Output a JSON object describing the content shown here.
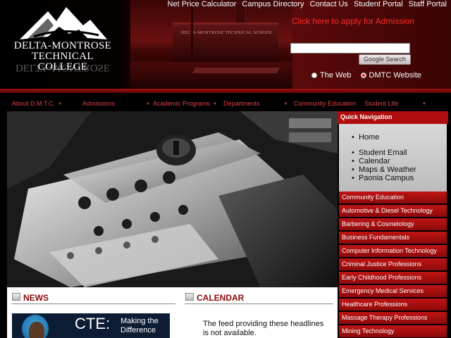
{
  "header": {
    "logo_name": "DELTA-MONTROSE",
    "logo_sub": "TECHNICAL COLLEGE",
    "photo_sign": "DELTA-MONTROSE TECHNICAL SCHOOL",
    "toplinks": [
      "Net Price Calculator",
      "Campus Directory",
      "Contact Us",
      "Student Portal",
      "Staff Portal"
    ],
    "apply_link": "Click here to apply for Admission",
    "search": {
      "value": "",
      "button_label": "Google Search"
    },
    "scope": {
      "options": [
        "The Web",
        "DMTC Website"
      ],
      "selected": "DMTC Website"
    }
  },
  "nav": [
    {
      "label": "About D.M.T.C."
    },
    {
      "label": "Admissions"
    },
    {
      "label": "Academic Programs"
    },
    {
      "label": "Departments"
    },
    {
      "label": "Community Education"
    },
    {
      "label": "Student Life"
    }
  ],
  "quick_nav": {
    "title": "Quick Navigation",
    "links": [
      "Home",
      "Student Email",
      "Calendar",
      "Maps & Weather",
      "Paonia Campus"
    ],
    "programs": [
      "Community Education",
      "Automotive & Diesel Technology",
      "Barbering & Cosmetology",
      "Business Fundamentals",
      "Computer Information Technology",
      "Criminal Justice Professions",
      "Early Childhood Professions",
      "Emergency Medical Services",
      "Healthcare Professions",
      "Massage Therapy Professions",
      "Mining Technology"
    ]
  },
  "news": {
    "title": "NEWS",
    "banner": {
      "big": "CTE:",
      "line1": "Making the",
      "line2": "Difference"
    }
  },
  "calendar": {
    "title": "CALENDAR",
    "message": "The feed providing these headlines is not available."
  },
  "colors": {
    "brand_red": "#b00e0e",
    "nav_text": "#e04040",
    "apply_link": "#ff2a2a",
    "heading": "#8a0a0a"
  },
  "icons": {
    "column_header": "feed-icon",
    "nav_caret": "chevron-down-icon"
  }
}
